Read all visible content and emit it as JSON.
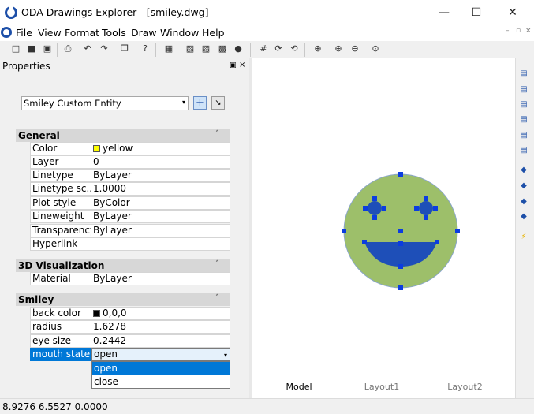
{
  "window": {
    "title": "ODA Drawings Explorer - [smiley.dwg]",
    "minimize_glyph": "—",
    "maximize_glyph": "☐",
    "close_glyph": "✕"
  },
  "menu": {
    "items": [
      "File",
      "View",
      "Format",
      "Tools",
      "Draw",
      "Window",
      "Help"
    ],
    "mdi_glyphs": [
      "–",
      "▫",
      "×"
    ]
  },
  "toolbar": {
    "icons": [
      "new-icon",
      "open-icon",
      "save-icon",
      "print-icon",
      "undo-icon",
      "redo-icon",
      "copy-icon",
      "help-icon",
      "render-icon",
      "cube-front-icon",
      "cube-back-icon",
      "cube-iso-icon",
      "sphere-icon",
      "snap-icon",
      "orbit-icon",
      "free-orbit-icon",
      "zoom-window-icon",
      "zoom-in-icon",
      "zoom-out-icon",
      "zoom-extents-icon"
    ],
    "glyphs": [
      "□",
      "■",
      "▣",
      "⎙",
      "↶",
      "↷",
      "❐",
      "?",
      "▦",
      "▧",
      "▨",
      "▩",
      "●",
      "#",
      "⟳",
      "⟲",
      "⊕",
      "⊕",
      "⊖",
      "⊙"
    ]
  },
  "properties": {
    "title": "Properties",
    "pin_glyph": "▣",
    "close_glyph": "×",
    "entity_selector": "Smiley Custom Entity",
    "combo_arrow": "▾",
    "add_glyph": "+",
    "pick_glyph": "↘",
    "sections": {
      "general": {
        "title": "General",
        "toggle": "˄",
        "rows": [
          {
            "name": "Color",
            "value": "yellow",
            "swatch": "#ffff00"
          },
          {
            "name": "Layer",
            "value": "0"
          },
          {
            "name": "Linetype",
            "value": "ByLayer"
          },
          {
            "name": "Linetype sc...",
            "value": "1.0000"
          },
          {
            "name": "Plot style",
            "value": "ByColor"
          },
          {
            "name": "Lineweight",
            "value": "ByLayer"
          },
          {
            "name": "Transparency",
            "value": "ByLayer"
          },
          {
            "name": "Hyperlink",
            "value": ""
          }
        ]
      },
      "visualization": {
        "title": "3D Visualization",
        "toggle": "˄",
        "rows": [
          {
            "name": "Material",
            "value": "ByLayer"
          }
        ]
      },
      "smiley": {
        "title": "Smiley",
        "toggle": "˄",
        "rows": [
          {
            "name": "back color",
            "value": "0,0,0",
            "swatch": "#000000"
          },
          {
            "name": "radius",
            "value": "1.6278"
          },
          {
            "name": "eye size",
            "value": "0.2442"
          },
          {
            "name": "mouth state",
            "value": "open"
          }
        ]
      }
    },
    "dropdown": {
      "arrow": "▾",
      "options": [
        "open",
        "close"
      ],
      "highlighted_index": 0
    }
  },
  "viewport": {
    "layout_tabs": [
      "Model",
      "Layout1",
      "Layout2"
    ],
    "active_tab": "Model",
    "smiley": {
      "face_color": "#9dbf6a",
      "feature_color": "#1e4fb8",
      "grip_color": "#0b3de0"
    }
  },
  "right_toolbar": {
    "icons": [
      "view-top-icon",
      "view-bottom-icon",
      "view-left-icon",
      "view-right-icon",
      "view-front-icon",
      "view-back-icon",
      "iso-sw-icon",
      "iso-se-icon",
      "iso-ne-icon",
      "iso-nw-icon",
      "lightning-icon"
    ],
    "glyphs": [
      "▤",
      "▤",
      "▤",
      "▤",
      "▤",
      "▤",
      "◆",
      "◆",
      "◆",
      "◆",
      "⚡"
    ]
  },
  "status": {
    "coordinates": "8.9276  6.5527  0.0000"
  }
}
